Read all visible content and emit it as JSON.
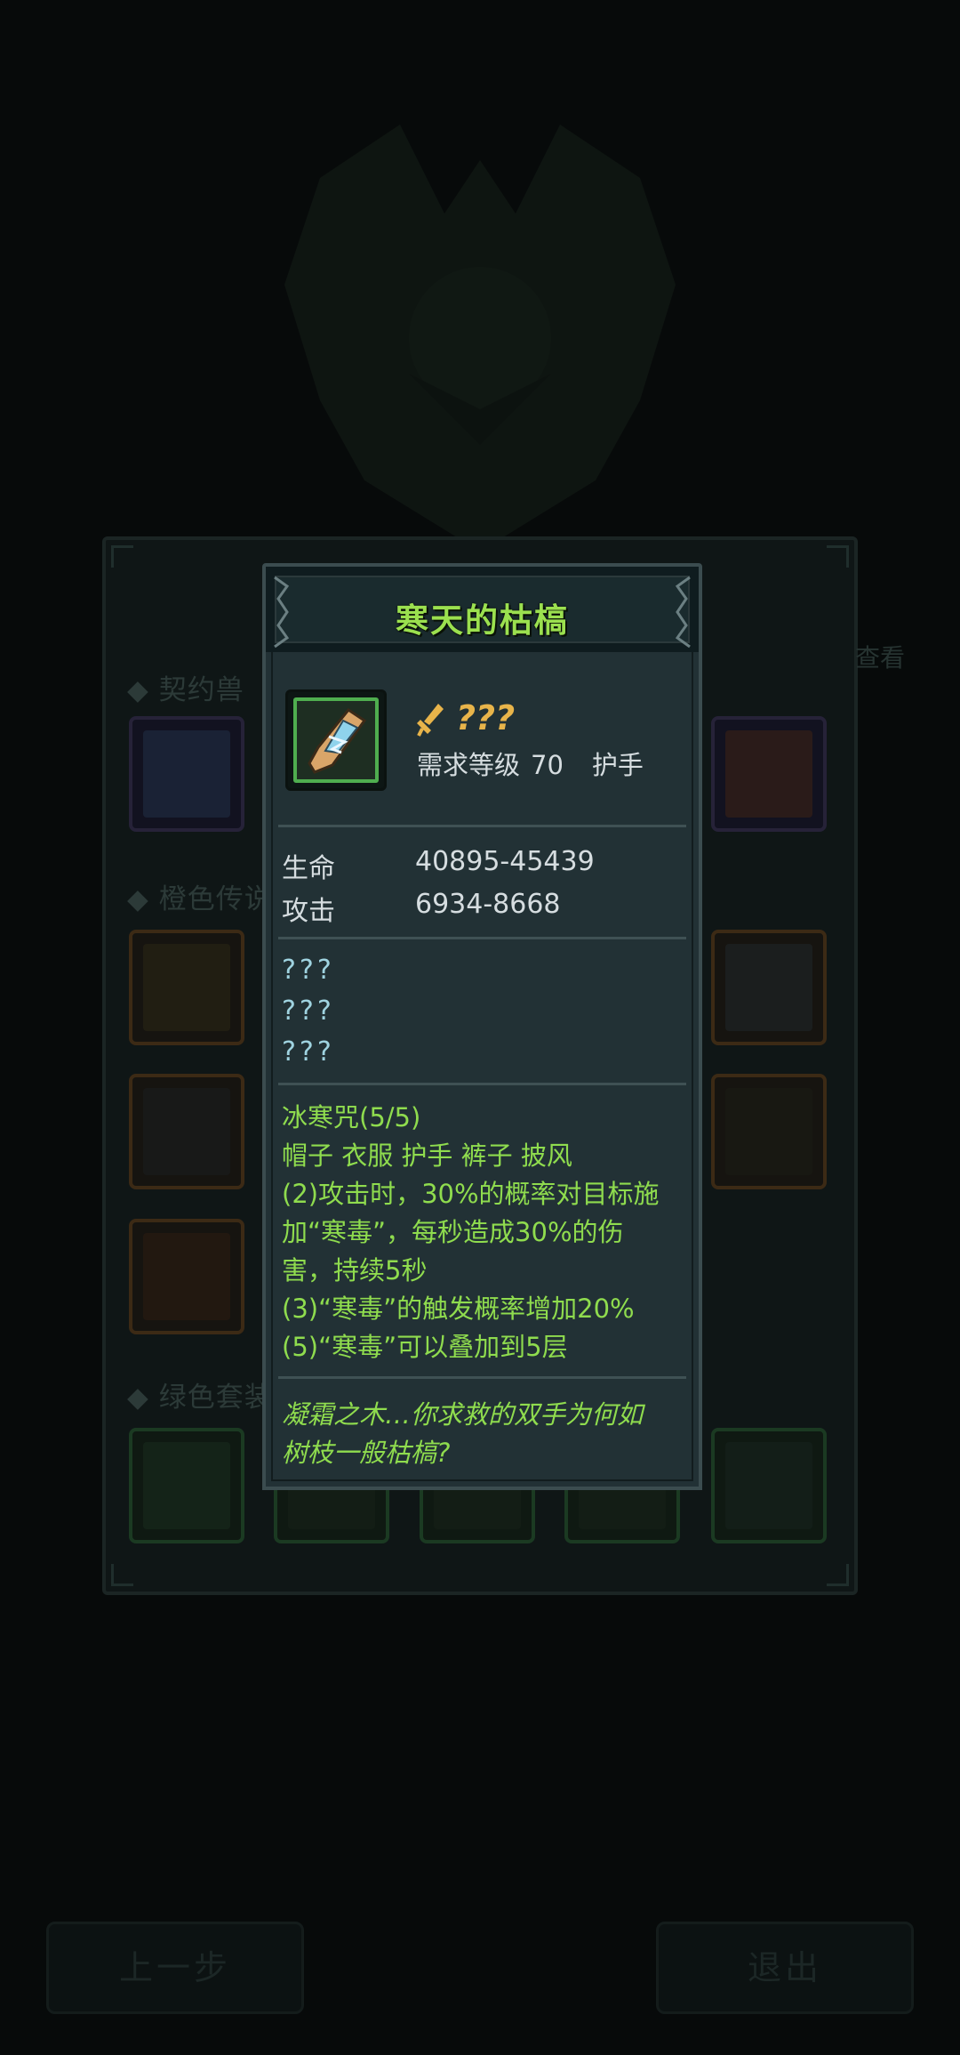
{
  "background": {
    "section_titles": [
      "契约兽",
      "橙色传说",
      "绿色套装"
    ],
    "side_label": "查看",
    "buttons": {
      "prev": "上一步",
      "exit": "退出"
    }
  },
  "tooltip": {
    "title": "寒天的枯槁",
    "quality_icon": "dagger-icon",
    "quality": "???",
    "requirement_label": "需求等级",
    "requirement_level": "70",
    "slot_type": "护手",
    "stats": [
      {
        "name": "生命",
        "value": "40895-45439"
      },
      {
        "name": "攻击",
        "value": "6934-8668"
      }
    ],
    "unknown_attributes": [
      "???",
      "???",
      "???"
    ],
    "set_bonus": {
      "name": "冰寒咒(5/5)",
      "pieces": "帽子 衣服 护手 裤子 披风",
      "lines": [
        "(2)攻击时，30%的概率对目标施",
        "加“寒毒”，每秒造成30%的伤",
        "害，持续5秒",
        "(3)“寒毒”的触发概率增加20%",
        "(5)“寒毒”可以叠加到5层"
      ]
    },
    "flavor_text": [
      "凝霜之木…你求救的双手为何如",
      "树枝一般枯槁?"
    ],
    "colors": {
      "title": "#9be04f",
      "set_text": "#8fdc4e",
      "quality": "#e8b44a",
      "unknown": "#9fd3e0",
      "panel": "#223135"
    }
  }
}
